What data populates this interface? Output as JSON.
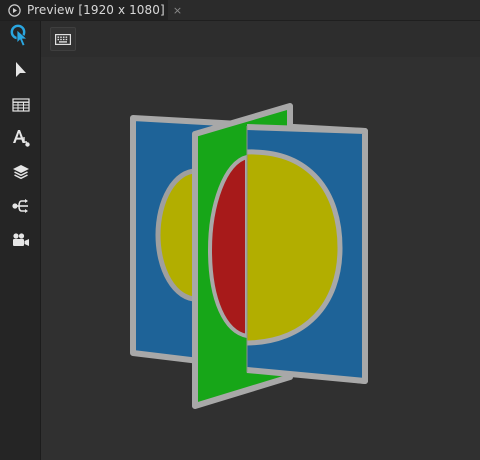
{
  "tab": {
    "title": "Preview [1920 x 1080]",
    "close_glyph": "×",
    "icon": "play-circle-icon"
  },
  "tools": [
    {
      "name": "interact-tool",
      "icon": "hand-pointer-icon",
      "active": true
    },
    {
      "name": "select-tool",
      "icon": "arrow-pointer-icon",
      "active": false
    },
    {
      "name": "table-tool",
      "icon": "table-icon",
      "active": false
    },
    {
      "name": "text-properties-tool",
      "icon": "text-format-icon",
      "active": false
    },
    {
      "name": "layers-tool",
      "icon": "layers-icon",
      "active": false
    },
    {
      "name": "bindings-tool",
      "icon": "connection-icon",
      "active": false
    },
    {
      "name": "camera-tool",
      "icon": "video-camera-icon",
      "active": false
    }
  ],
  "toolbar": {
    "keyboard_icon": "keyboard-icon"
  },
  "colors": {
    "blue_panel": "#1e6398",
    "green_panel": "#17a618",
    "yellow_disc": "#b2ae00",
    "red_disc": "#a71a1a",
    "frame_gray": "#a8a8a8",
    "accent_blue": "#2aa6e0"
  }
}
